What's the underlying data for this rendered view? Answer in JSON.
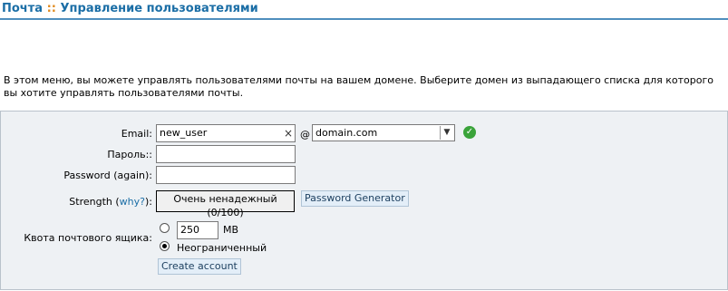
{
  "header": {
    "section": "Почта",
    "separator": "::",
    "page_title": "Управление пользователями"
  },
  "intro": "В этом меню, вы можете управлять пользователями почты на вашем домене. Выберите домен из выпадающего списка для которого вы хотите управлять пользователями почты.",
  "form": {
    "email_label": "Email:",
    "email_value": "new_user",
    "clear_glyph": "×",
    "at_sign": "@",
    "domain_value": "domain.com",
    "password_label": "Пароль::",
    "password_again_label": "Password (again):",
    "strength_label": "Strength",
    "strength_open": "(",
    "why_link": "why?",
    "strength_close": "):",
    "strength_text": "Очень ненадежный",
    "strength_score": "(0/100)",
    "password_generator": "Password Generator",
    "quota_label": "Квота почтового ящика:",
    "quota_value": "250",
    "quota_unit": "MB",
    "unlimited_label": "Неограниченный",
    "create_button": "Create account"
  },
  "colors": {
    "accent": "#1b6ea6",
    "separator": "#e08a1e",
    "panel_bg": "#eef1f4",
    "ok": "#3aa33a"
  },
  "icons": {
    "domain_ok": "check-circle-icon"
  }
}
